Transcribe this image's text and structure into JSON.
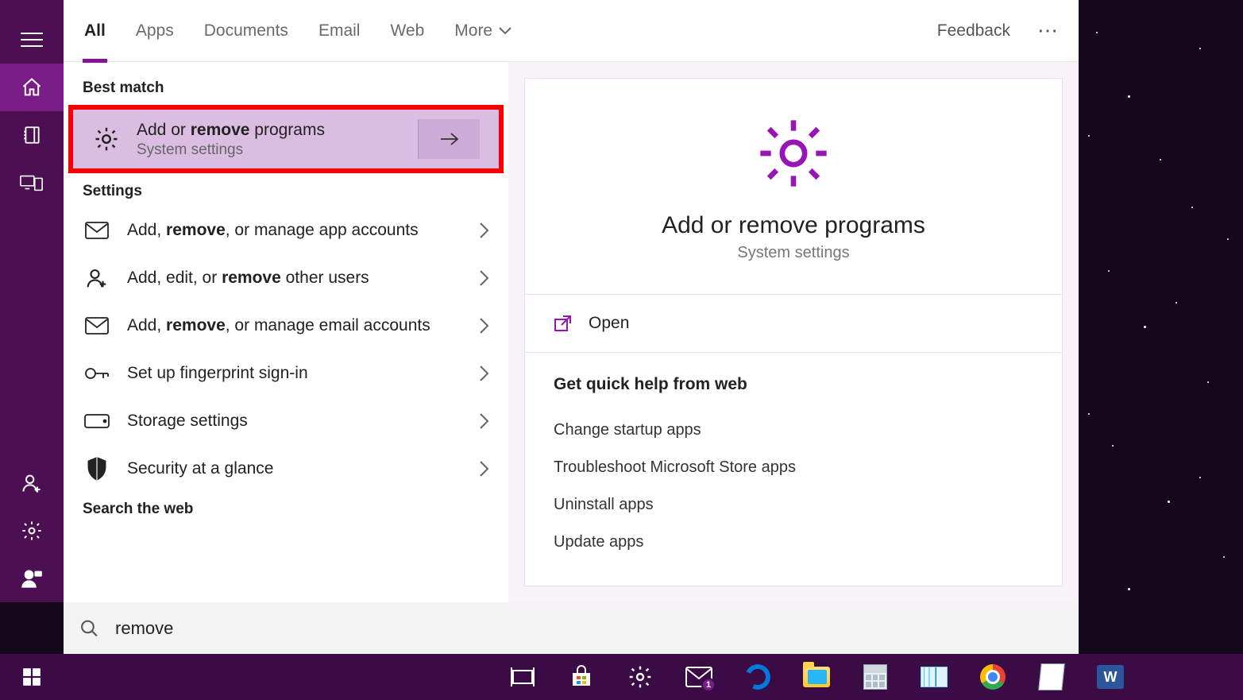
{
  "tabs": {
    "all": "All",
    "apps": "Apps",
    "documents": "Documents",
    "email": "Email",
    "web": "Web",
    "more": "More"
  },
  "feedback": "Feedback",
  "sections": {
    "best": "Best match",
    "settings": "Settings",
    "searchweb": "Search the web"
  },
  "best_match": {
    "title_pre": "Add or ",
    "title_kw": "remove",
    "title_post": " programs",
    "sub": "System settings"
  },
  "settings_items": [
    {
      "pre": "Add, ",
      "kw": "remove",
      "post": ", or manage app accounts",
      "icon": "mail"
    },
    {
      "pre": "Add, edit, or ",
      "kw": "remove",
      "post": " other users",
      "icon": "useradd"
    },
    {
      "pre": "Add, ",
      "kw": "remove",
      "post": ", or manage email accounts",
      "icon": "mail"
    },
    {
      "pre": "",
      "kw": "",
      "post": "Set up fingerprint sign-in",
      "icon": "key"
    },
    {
      "pre": "",
      "kw": "",
      "post": "Storage settings",
      "icon": "storage"
    },
    {
      "pre": "",
      "kw": "",
      "post": "Security at a glance",
      "icon": "shield"
    }
  ],
  "preview": {
    "title": "Add or remove programs",
    "sub": "System settings",
    "open": "Open",
    "help_header": "Get quick help from web",
    "links": [
      "Change startup apps",
      "Troubleshoot Microsoft Store apps",
      "Uninstall apps",
      "Update apps"
    ]
  },
  "search": {
    "value": "remove"
  },
  "mail_badge": "1"
}
